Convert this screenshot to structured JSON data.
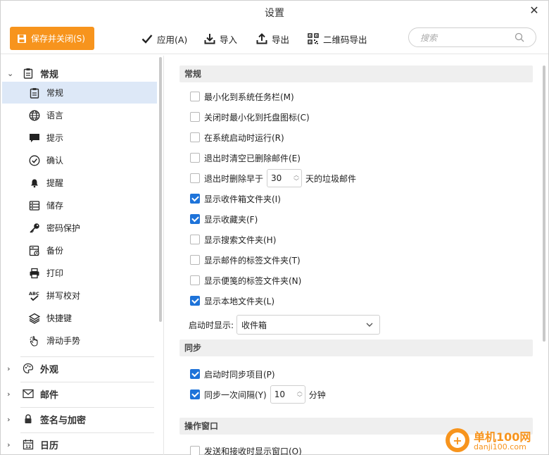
{
  "window": {
    "title": "设置"
  },
  "toolbar": {
    "save_label": "保存并关闭(S)",
    "apply_label": "应用(A)",
    "import_label": "导入",
    "export_label": "导出",
    "qr_export_label": "二维码导出",
    "search_placeholder": "搜索"
  },
  "sidebar": {
    "groups": [
      {
        "label": "常规",
        "expanded": true
      },
      {
        "label": "外观",
        "expanded": false
      },
      {
        "label": "邮件",
        "expanded": false
      },
      {
        "label": "签名与加密",
        "expanded": false
      },
      {
        "label": "日历",
        "expanded": false
      }
    ],
    "items": [
      {
        "label": "常规",
        "icon": "clipboard-icon",
        "active": true
      },
      {
        "label": "语言",
        "icon": "globe-icon"
      },
      {
        "label": "提示",
        "icon": "speech-bubble-icon"
      },
      {
        "label": "确认",
        "icon": "check-circle-icon"
      },
      {
        "label": "提醒",
        "icon": "bell-icon"
      },
      {
        "label": "储存",
        "icon": "storage-icon"
      },
      {
        "label": "密码保护",
        "icon": "key-icon"
      },
      {
        "label": "备份",
        "icon": "backup-icon"
      },
      {
        "label": "打印",
        "icon": "printer-icon"
      },
      {
        "label": "拼写校对",
        "icon": "spellcheck-icon"
      },
      {
        "label": "快捷键",
        "icon": "layers-icon"
      },
      {
        "label": "滑动手势",
        "icon": "hand-gesture-icon"
      }
    ]
  },
  "general": {
    "section_title": "常规",
    "options": [
      {
        "label": "最小化到系统任务栏(M)",
        "checked": false
      },
      {
        "label": "关闭时最小化到托盘图标(C)",
        "checked": false
      },
      {
        "label": "在系统启动时运行(R)",
        "checked": false
      },
      {
        "label": "退出时清空已删除邮件(E)",
        "checked": false
      }
    ],
    "delete_older": {
      "prefix": "退出时删除早于",
      "value": "30",
      "suffix": "天的垃圾邮件",
      "checked": false
    },
    "folders": [
      {
        "label": "显示收件箱文件夹(I)",
        "checked": true
      },
      {
        "label": "显示收藏夹(F)",
        "checked": true
      },
      {
        "label": "显示搜索文件夹(H)",
        "checked": false
      },
      {
        "label": "显示邮件的标签文件夹(T)",
        "checked": false
      },
      {
        "label": "显示便笺的标签文件夹(N)",
        "checked": false
      },
      {
        "label": "显示本地文件夹(L)",
        "checked": true
      }
    ],
    "startup_show_label": "启动时显示:",
    "startup_show_value": "收件箱"
  },
  "sync": {
    "section_title": "同步",
    "sync_on_start": {
      "label": "启动时同步项目(P)",
      "checked": true
    },
    "sync_interval": {
      "label": "同步一次间隔(Y)",
      "value": "10",
      "suffix": "分钟",
      "checked": true
    }
  },
  "action_window": {
    "section_title": "操作窗口",
    "show_on_send": {
      "label": "发送和接收时显示窗口(O)",
      "checked": false
    }
  },
  "watermark": {
    "name": "单机100网",
    "url": "danji100.com"
  },
  "colors": {
    "accent": "#f7941d",
    "checkbox": "#1e73d9",
    "selected_row": "#dde8f7"
  }
}
